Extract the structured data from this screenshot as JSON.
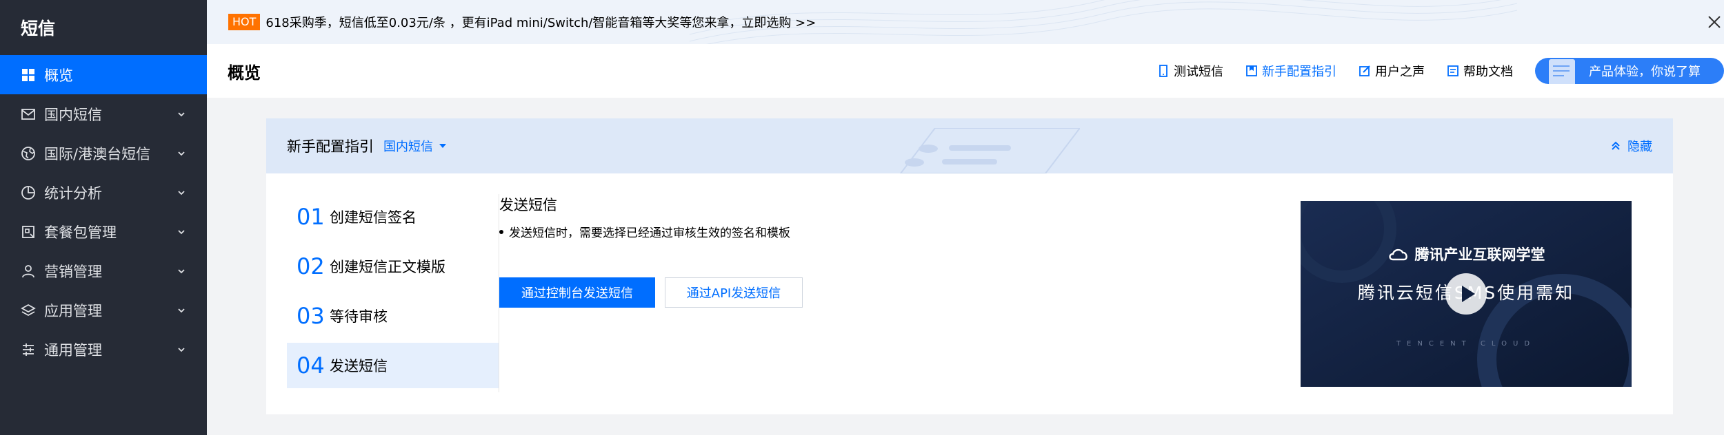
{
  "sidebar": {
    "title": "短信",
    "items": [
      {
        "label": "概览"
      },
      {
        "label": "国内短信"
      },
      {
        "label": "国际/港澳台短信"
      },
      {
        "label": "统计分析"
      },
      {
        "label": "套餐包管理"
      },
      {
        "label": "营销管理"
      },
      {
        "label": "应用管理"
      },
      {
        "label": "通用管理"
      }
    ]
  },
  "banner": {
    "badge": "HOT",
    "text": "618采购季，短信低至0.03元/条 ，更有iPad mini/Switch/智能音箱等大奖等您来拿，立即选购 >>"
  },
  "header": {
    "title": "概览",
    "links": {
      "test": "测试短信",
      "guide": "新手配置指引",
      "voice": "用户之声",
      "docs": "帮助文档"
    },
    "feedback": "产品体验，你说了算"
  },
  "guide": {
    "title": "新手配置指引",
    "select": "国内短信",
    "hide": "隐藏",
    "steps": [
      {
        "num": "01",
        "label": "创建短信签名"
      },
      {
        "num": "02",
        "label": "创建短信正文模版"
      },
      {
        "num": "03",
        "label": "等待审核"
      },
      {
        "num": "04",
        "label": "发送短信"
      }
    ],
    "detail": {
      "title": "发送短信",
      "bullet": "发送短信时，需要选择已经通过审核生效的签名和模板",
      "primary_btn": "通过控制台发送短信",
      "secondary_btn": "通过API发送短信"
    },
    "video": {
      "brand": "腾讯产业互联网学堂",
      "title": "腾讯云短信SMS使用需知",
      "sub": "TENCENT CLOUD"
    }
  },
  "colors": {
    "accent": "#006eff",
    "sidebar_bg": "#262b36",
    "hot": "#ff7200"
  }
}
